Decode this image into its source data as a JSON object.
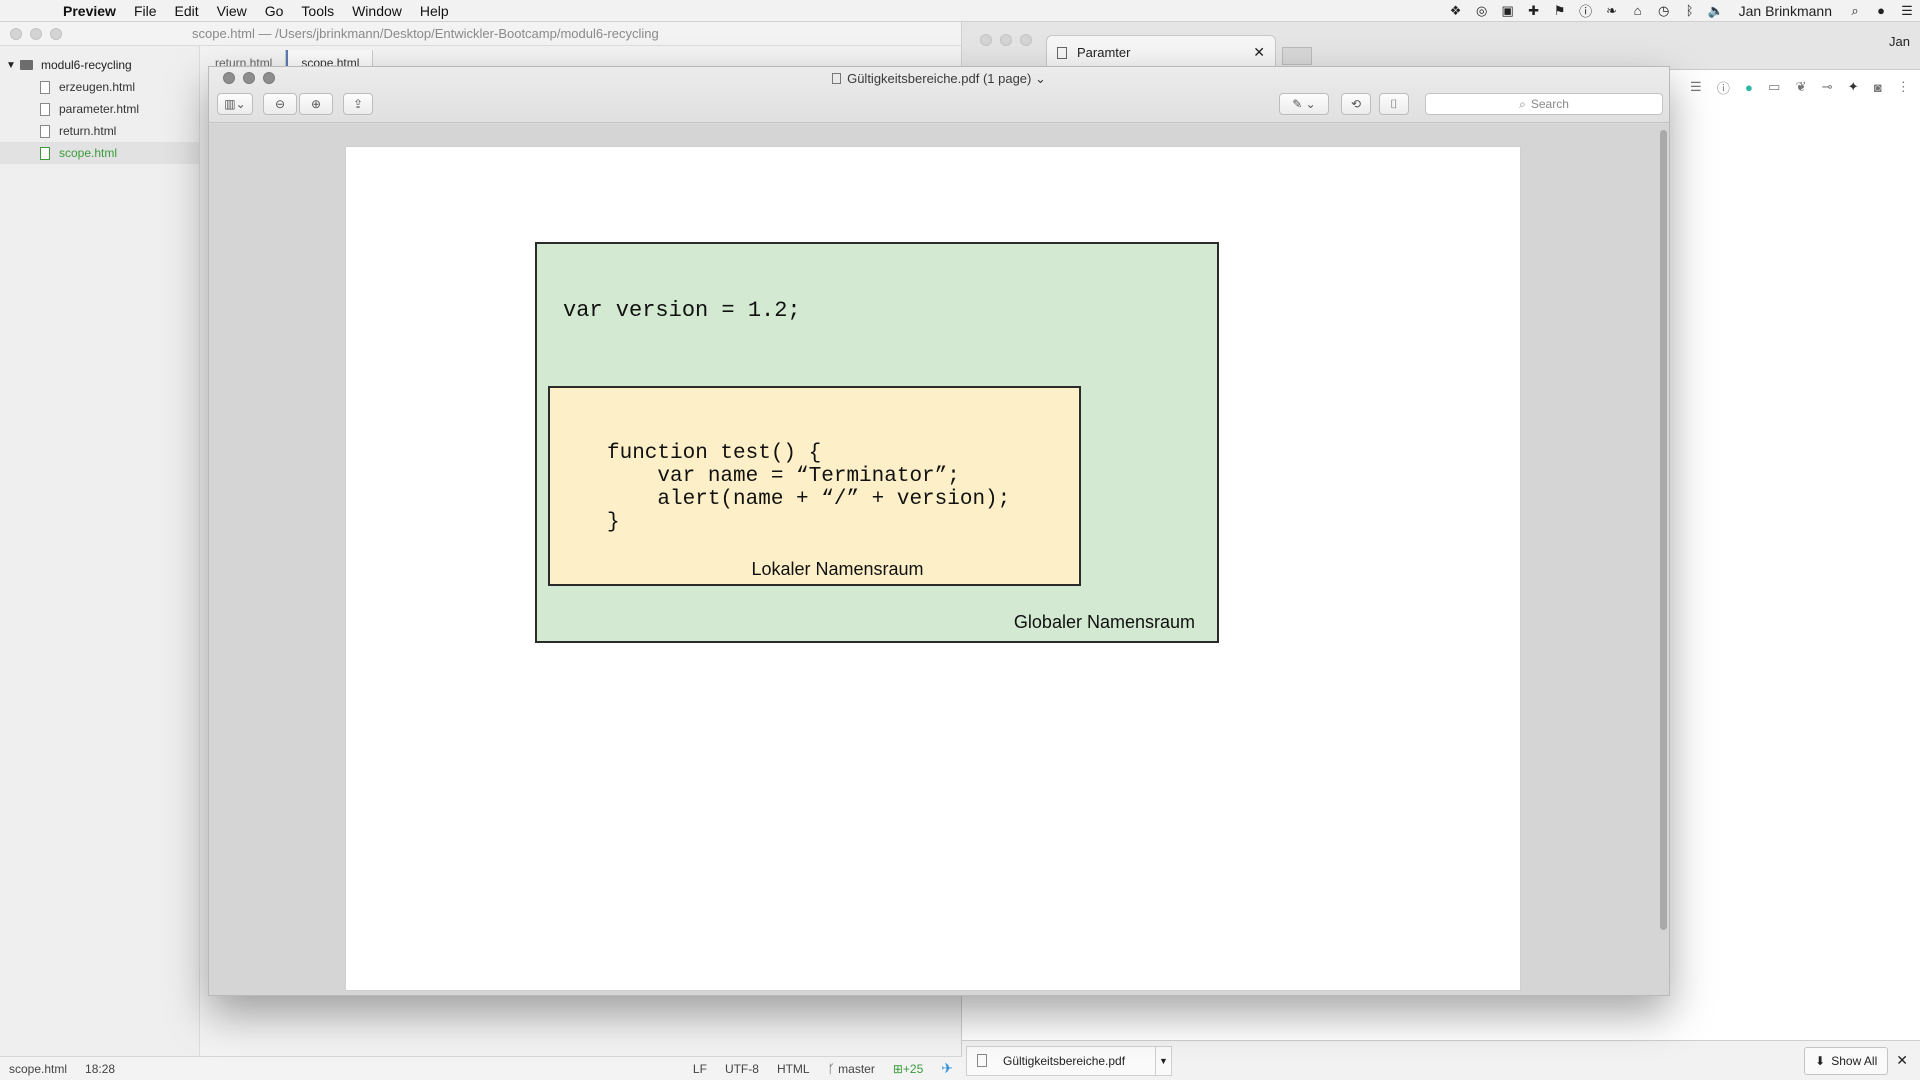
{
  "menubar": {
    "app": "Preview",
    "items": [
      "File",
      "Edit",
      "View",
      "Go",
      "Tools",
      "Window",
      "Help"
    ],
    "user": "Jan Brinkmann"
  },
  "editor": {
    "path": "scope.html — /Users/jbrinkmann/Desktop/Entwickler-Bootcamp/modul6-recycling",
    "folder": "modul6-recycling",
    "files": [
      "erzeugen.html",
      "parameter.html",
      "return.html",
      "scope.html"
    ],
    "active_file": "scope.html",
    "tabs": [
      "return.html",
      "scope.html"
    ],
    "status": {
      "file": "scope.html",
      "cursor": "18:28",
      "line_ending": "LF",
      "encoding": "UTF-8",
      "grammar": "HTML",
      "branch": "master",
      "git_changes": "+25"
    }
  },
  "browser": {
    "tab_title": "Paramter",
    "profile": "Jan",
    "download_file": "Gültigkeitsbereiche.pdf",
    "show_all": "Show All"
  },
  "preview": {
    "title": "Gültigkeitsbereiche.pdf (1 page)",
    "search_placeholder": "Search",
    "diagram": {
      "global_code": "var version = 1.2;",
      "local_code": [
        "function test() {",
        "    var name = “Terminator”;",
        "    alert(name + “/” + version);",
        "}"
      ],
      "local_label": "Lokaler Namensraum",
      "global_label": "Globaler Namensraum"
    }
  }
}
